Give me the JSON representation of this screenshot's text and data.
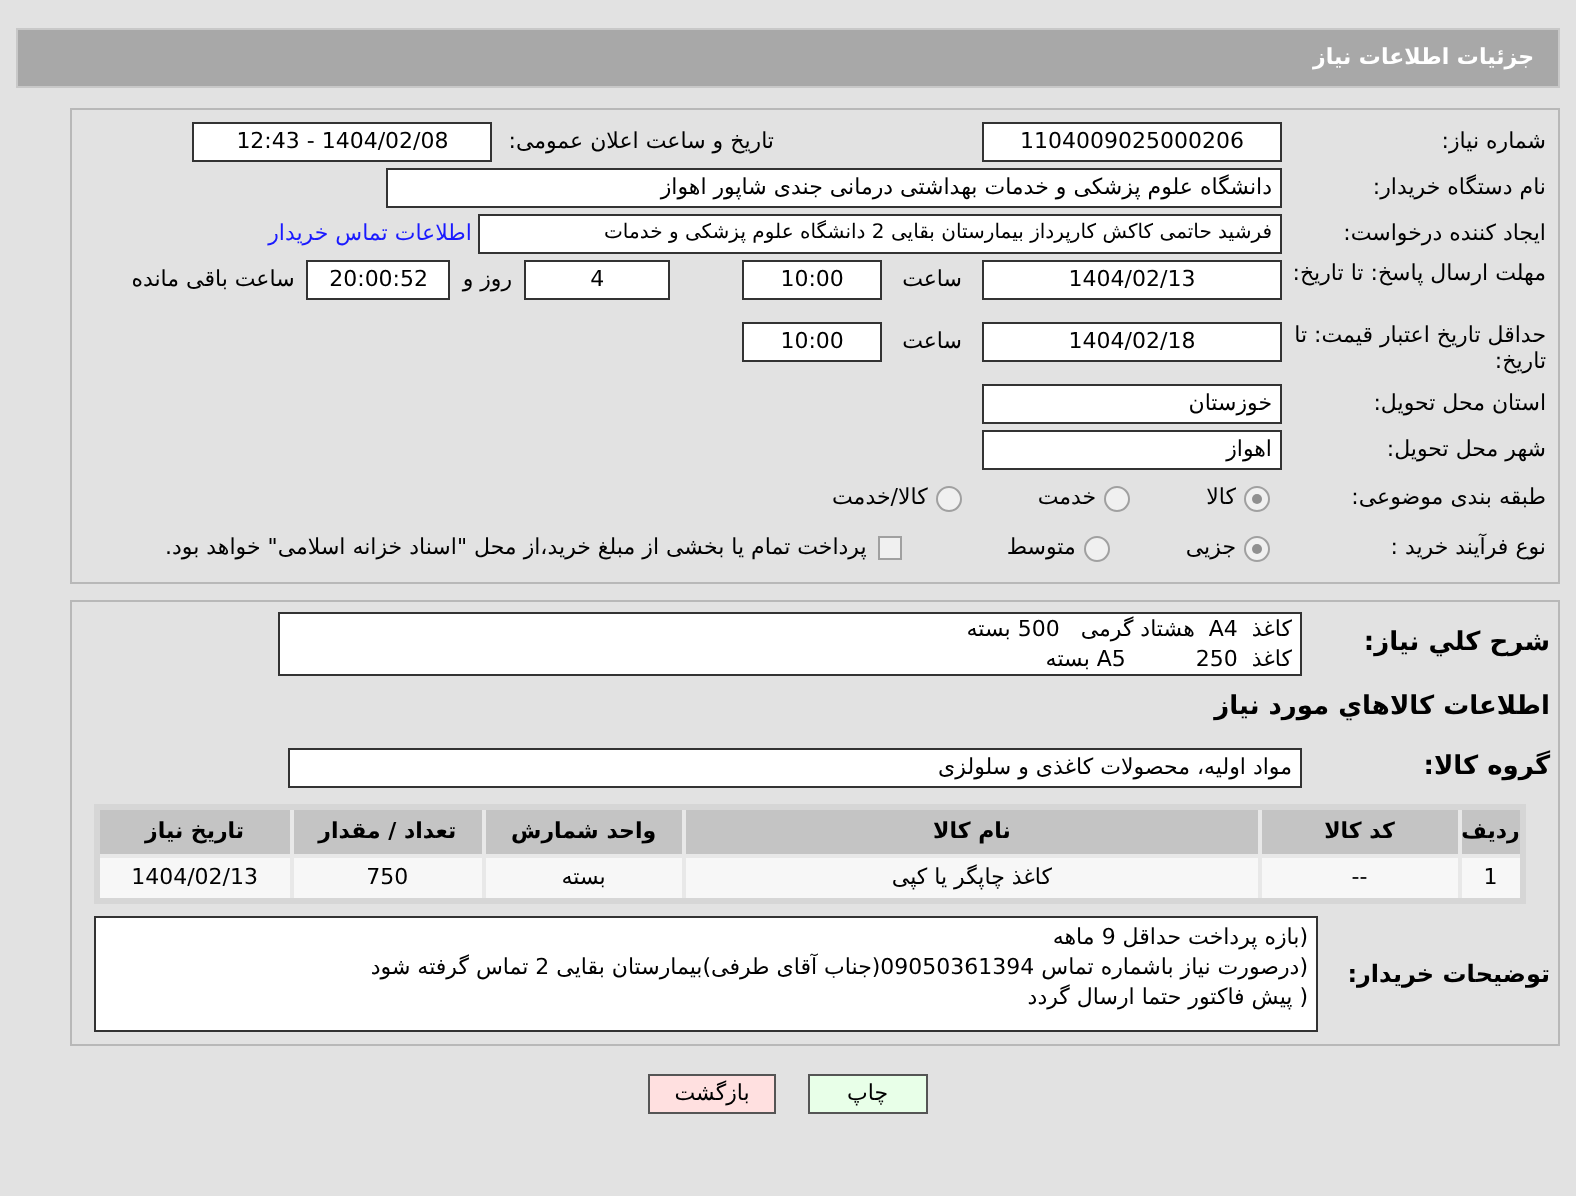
{
  "header": {
    "title": "جزئیات اطلاعات نیاز"
  },
  "need_number": {
    "label": "شماره نیاز:",
    "value": "1104009025000206"
  },
  "announce": {
    "label": "تاریخ و ساعت اعلان عمومی:",
    "value": "1404/02/08 - 12:43"
  },
  "buyer_org": {
    "label": "نام دستگاه خریدار:",
    "value": "دانشگاه علوم پزشکی و خدمات بهداشتی درمانی جندی شاپور اهواز"
  },
  "requester": {
    "label": "ایجاد کننده درخواست:",
    "value": "فرشید حاتمی کاکش کارپرداز بیمارستان بقایی 2 دانشگاه علوم پزشکی و خدمات",
    "link": "اطلاعات تماس خریدار"
  },
  "reply_deadline": {
    "label": "مهلت ارسال پاسخ: تا تاریخ:",
    "date": "1404/02/13",
    "time_label": "ساعت",
    "time": "10:00",
    "days": "4",
    "days_label": "روز و",
    "remaining": "20:00:52",
    "remaining_label": "ساعت باقی مانده"
  },
  "price_validity": {
    "label": "حداقل تاریخ اعتبار قیمت: تا تاریخ:",
    "date": "1404/02/18",
    "time_label": "ساعت",
    "time": "10:00"
  },
  "province": {
    "label": "استان محل تحویل:",
    "value": "خوزستان"
  },
  "city": {
    "label": "شهر محل تحویل:",
    "value": "اهواز"
  },
  "category": {
    "label": "طبقه بندی موضوعی:",
    "options": [
      {
        "label": "کالا",
        "selected": true
      },
      {
        "label": "خدمت",
        "selected": false
      },
      {
        "label": "کالا/خدمت",
        "selected": false
      }
    ]
  },
  "process": {
    "label": "نوع فرآیند خرید :",
    "options": [
      {
        "label": "جزیی",
        "selected": true
      },
      {
        "label": "متوسط",
        "selected": false
      }
    ],
    "treasury": {
      "checked": false,
      "label": "پرداخت تمام یا بخشی از مبلغ خرید،از محل \"اسناد خزانه اسلامی\" خواهد بود."
    }
  },
  "description": {
    "label": "شرح کلي نياز:",
    "lines": [
      "کاغذ  A4  هشتاد گرمی   500 بسته",
      "کاغذ  A5          250 بسته"
    ]
  },
  "goods_heading": "اطلاعات كالاهاي مورد نياز",
  "goods_group": {
    "label": "گروه کالا:",
    "value": "مواد اولیه، محصولات کاغذی و سلولزی"
  },
  "table": {
    "columns": [
      "ردیف",
      "کد کالا",
      "نام کالا",
      "واحد شمارش",
      "تعداد / مقدار",
      "تاریخ نیاز"
    ],
    "rows": [
      [
        "1",
        "--",
        "کاغذ چاپگر یا کپی",
        "بسته",
        "750",
        "1404/02/13"
      ]
    ]
  },
  "buyer_notes": {
    "label": "توضیحات خریدار:",
    "lines": [
      "(بازه پرداخت حداقل 9 ماهه",
      "(درصورت نیاز باشماره تماس 09050361394(جناب آقای طرفی)بیمارستان بقایی 2 تماس گرفته شود",
      "( پیش فاکتور حتما ارسال گردد"
    ]
  },
  "buttons": [
    {
      "label": "چاپ",
      "kind": "print"
    },
    {
      "label": "بازگشت",
      "kind": "back"
    }
  ]
}
